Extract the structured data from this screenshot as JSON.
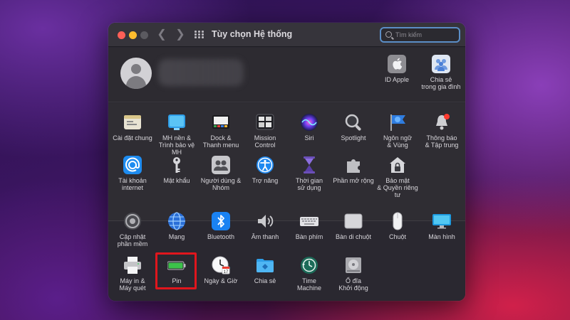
{
  "window": {
    "title": "Tùy chọn Hệ thống",
    "search_placeholder": "Tìm kiếm"
  },
  "profile": {
    "apple_id_label": "ID Apple",
    "family_label": "Chia sẻ\ntrong gia đình"
  },
  "section1": [
    {
      "id": "general",
      "label": "Cài đặt chung",
      "icon": "general-icon"
    },
    {
      "id": "desktop",
      "label": "MH nền &\nTrình bảo vệ MH",
      "icon": "desktop-screensaver-icon"
    },
    {
      "id": "dock",
      "label": "Dock &\nThanh menu",
      "icon": "dock-icon"
    },
    {
      "id": "mission",
      "label": "Mission\nControl",
      "icon": "mission-control-icon"
    },
    {
      "id": "siri",
      "label": "Siri",
      "icon": "siri-icon"
    },
    {
      "id": "spotlight",
      "label": "Spotlight",
      "icon": "spotlight-icon"
    },
    {
      "id": "language",
      "label": "Ngôn ngữ\n& Vùng",
      "icon": "language-region-icon"
    },
    {
      "id": "notifications",
      "label": "Thông báo\n& Tập trung",
      "icon": "notifications-icon"
    },
    {
      "id": "internet",
      "label": "Tài khoản\ninternet",
      "icon": "internet-accounts-icon"
    },
    {
      "id": "passwords",
      "label": "Mật khẩu",
      "icon": "passwords-icon"
    },
    {
      "id": "users",
      "label": "Người dùng &\nNhóm",
      "icon": "users-groups-icon"
    },
    {
      "id": "accessibility",
      "label": "Trợ năng",
      "icon": "accessibility-icon"
    },
    {
      "id": "screentime",
      "label": "Thời gian\nsử dụng",
      "icon": "screen-time-icon"
    },
    {
      "id": "extensions",
      "label": "Phần mở rộng",
      "icon": "extensions-icon"
    },
    {
      "id": "security",
      "label": "Bảo mật\n& Quyền riêng tư",
      "icon": "security-privacy-icon"
    }
  ],
  "section2": [
    {
      "id": "update",
      "label": "Cập nhật\nphần mềm",
      "icon": "software-update-icon"
    },
    {
      "id": "network",
      "label": "Mạng",
      "icon": "network-icon"
    },
    {
      "id": "bluetooth",
      "label": "Bluetooth",
      "icon": "bluetooth-icon"
    },
    {
      "id": "sound",
      "label": "Âm thanh",
      "icon": "sound-icon"
    },
    {
      "id": "keyboard",
      "label": "Bàn phím",
      "icon": "keyboard-icon"
    },
    {
      "id": "trackpad",
      "label": "Bàn di chuột",
      "icon": "trackpad-icon"
    },
    {
      "id": "mouse",
      "label": "Chuột",
      "icon": "mouse-icon"
    },
    {
      "id": "displays",
      "label": "Màn hình",
      "icon": "displays-icon"
    },
    {
      "id": "printers",
      "label": "Máy in &\nMáy quét",
      "icon": "printers-scanners-icon"
    },
    {
      "id": "battery",
      "label": "Pin",
      "icon": "battery-icon"
    },
    {
      "id": "datetime",
      "label": "Ngày & Giờ",
      "icon": "date-time-icon"
    },
    {
      "id": "sharing",
      "label": "Chia sẻ",
      "icon": "sharing-icon"
    },
    {
      "id": "timemachine",
      "label": "Time\nMachine",
      "icon": "time-machine-icon"
    },
    {
      "id": "startup",
      "label": "Ổ đĩa\nKhởi động",
      "icon": "startup-disk-icon"
    }
  ],
  "badges": {
    "notifications_dot": "#ff3b30"
  },
  "highlighted_item": "battery",
  "colors": {
    "highlight": "#e0161d",
    "search_focus": "#5b8ec7"
  }
}
